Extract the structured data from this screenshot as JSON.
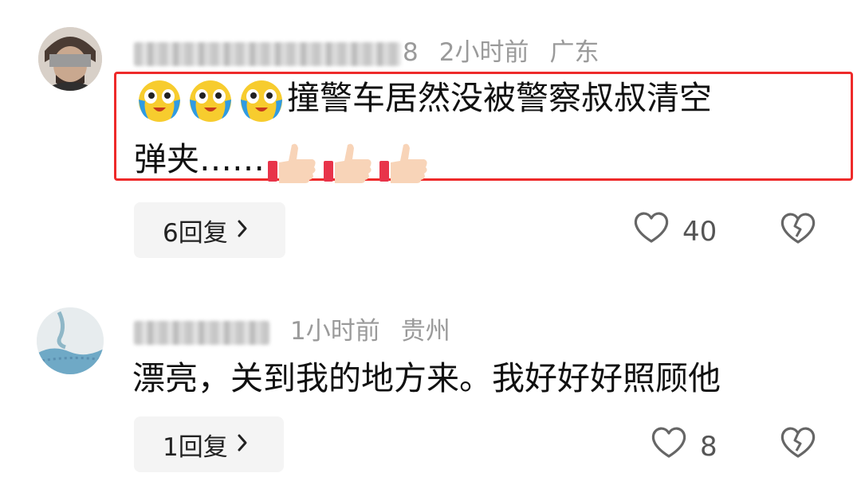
{
  "comments": [
    {
      "username_visible_suffix": "8",
      "time": "2小时前",
      "location": "广东",
      "text_line1": "撞警车居然没被警察叔叔清空",
      "text_line2": "弹夹……",
      "replies_label": "6回复",
      "like_count": "40",
      "highlighted": true,
      "highlight_color": "#ee2a2a"
    },
    {
      "username_visible_suffix": "",
      "time": "1小时前",
      "location": "贵州",
      "text": "漂亮，关到我的地方来。我好好好照顾他",
      "replies_label": "1回复",
      "like_count": "8",
      "highlighted": false
    }
  ],
  "icons": {
    "lead_emojis": "crying-laughing-face-emoji",
    "trail_emojis": "thumbs-up-emoji",
    "like": "heart-outline-icon",
    "dislike": "broken-heart-icon",
    "replies": "chevron-right-icon"
  }
}
